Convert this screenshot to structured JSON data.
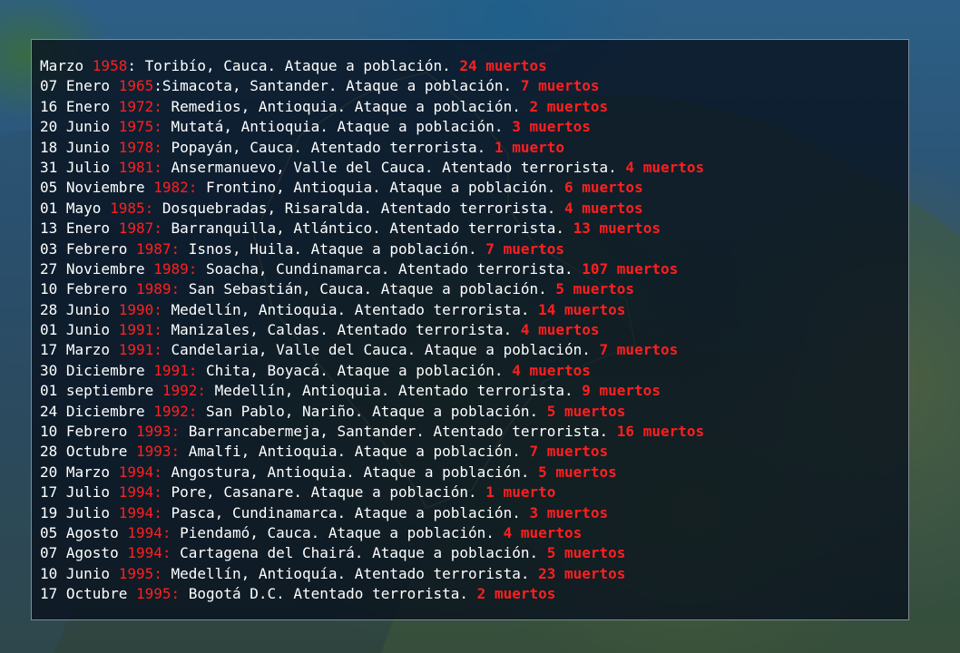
{
  "events": [
    {
      "date": "Marzo ",
      "year": "1958",
      "sep": ": ",
      "desc": "Toribío, Cauca. Ataque a población. ",
      "deaths": "24 muertos"
    },
    {
      "date": "07 Enero ",
      "year": "1965",
      "sep": ":",
      "desc": "Simacota, Santander. Ataque a población. ",
      "deaths": "7 muertos"
    },
    {
      "date": "16 Enero ",
      "year": "1972:",
      "sep": " ",
      "desc": "Remedios, Antioquia. Ataque a población. ",
      "deaths": "2 muertos"
    },
    {
      "date": "20 Junio ",
      "year": "1975:",
      "sep": " ",
      "desc": "Mutatá, Antioquia. Ataque a población. ",
      "deaths": "3 muertos"
    },
    {
      "date": "18 Junio ",
      "year": "1978:",
      "sep": " ",
      "desc": "Popayán, Cauca. Atentado terrorista. ",
      "deaths": "1 muerto"
    },
    {
      "date": "31 Julio ",
      "year": "1981:",
      "sep": " ",
      "desc": "Ansermanuevo, Valle del Cauca. Atentado terrorista. ",
      "deaths": "4 muertos"
    },
    {
      "date": "05 Noviembre ",
      "year": "1982:",
      "sep": " ",
      "desc": "Frontino, Antioquia. Ataque a población. ",
      "deaths": "6 muertos"
    },
    {
      "date": "01 Mayo ",
      "year": "1985:",
      "sep": " ",
      "desc": "Dosquebradas, Risaralda. Atentado terrorista. ",
      "deaths": "4 muertos"
    },
    {
      "date": "13 Enero ",
      "year": "1987:",
      "sep": " ",
      "desc": "Barranquilla, Atlántico. Atentado terrorista. ",
      "deaths": "13 muertos"
    },
    {
      "date": "03 Febrero ",
      "year": "1987:",
      "sep": " ",
      "desc": "Isnos, Huila. Ataque a población. ",
      "deaths": "7 muertos"
    },
    {
      "date": "27 Noviembre ",
      "year": "1989:",
      "sep": " ",
      "desc": "Soacha, Cundinamarca. Atentado terrorista. ",
      "deaths": "107 muertos"
    },
    {
      "date": "10 Febrero ",
      "year": "1989:",
      "sep": " ",
      "desc": "San Sebastián, Cauca. Ataque a población. ",
      "deaths": "5 muertos"
    },
    {
      "date": "28 Junio ",
      "year": "1990:",
      "sep": " ",
      "desc": "Medellín, Antioquia. Atentado terrorista. ",
      "deaths": "14 muertos"
    },
    {
      "date": "01 Junio ",
      "year": "1991:",
      "sep": " ",
      "desc": "Manizales, Caldas. Atentado terrorista. ",
      "deaths": "4 muertos"
    },
    {
      "date": "17 Marzo ",
      "year": "1991:",
      "sep": " ",
      "desc": "Candelaria, Valle del Cauca. Ataque a población. ",
      "deaths": "7 muertos"
    },
    {
      "date": "30 Diciembre ",
      "year": "1991:",
      "sep": " ",
      "desc": "Chita, Boyacá. Ataque a población. ",
      "deaths": "4 muertos"
    },
    {
      "date": "01 septiembre ",
      "year": "1992:",
      "sep": " ",
      "desc": "Medellín, Antioquia. Atentado terrorista. ",
      "deaths": "9 muertos"
    },
    {
      "date": "24 Diciembre ",
      "year": "1992:",
      "sep": " ",
      "desc": "San Pablo, Nariño. Ataque a población. ",
      "deaths": "5 muertos"
    },
    {
      "date": "10 Febrero ",
      "year": "1993:",
      "sep": " ",
      "desc": "Barrancabermeja, Santander. Atentado terrorista. ",
      "deaths": "16 muertos"
    },
    {
      "date": "28 Octubre ",
      "year": "1993:",
      "sep": " ",
      "desc": "Amalfi, Antioquia. Ataque a población. ",
      "deaths": "7 muertos"
    },
    {
      "date": "20 Marzo ",
      "year": "1994:",
      "sep": " ",
      "desc": "Angostura, Antioquia. Ataque a población. ",
      "deaths": "5 muertos"
    },
    {
      "date": "17 Julio ",
      "year": "1994:",
      "sep": " ",
      "desc": "Pore, Casanare. Ataque a población. ",
      "deaths": "1 muerto"
    },
    {
      "date": "19 Julio ",
      "year": "1994:",
      "sep": " ",
      "desc": "Pasca, Cundinamarca. Ataque a población. ",
      "deaths": "3 muertos"
    },
    {
      "date": "05 Agosto ",
      "year": "1994:",
      "sep": " ",
      "desc": "Piendamó, Cauca. Ataque a población. ",
      "deaths": "4 muertos"
    },
    {
      "date": "07 Agosto ",
      "year": "1994:",
      "sep": " ",
      "desc": "Cartagena del Chairá. Ataque a población. ",
      "deaths": "5 muertos"
    },
    {
      "date": "10 Junio ",
      "year": "1995:",
      "sep": " ",
      "desc": "Medellín, Antioquía. Atentado terrorista. ",
      "deaths": "23 muertos"
    },
    {
      "date": "17 Octubre ",
      "year": "1995:",
      "sep": " ",
      "desc": "Bogotá D.C. Atentado terrorista. ",
      "deaths": "2 muertos"
    }
  ],
  "colors": {
    "text": "#ffffff",
    "highlight": "#ff1f1f",
    "panel": "#06101c"
  }
}
